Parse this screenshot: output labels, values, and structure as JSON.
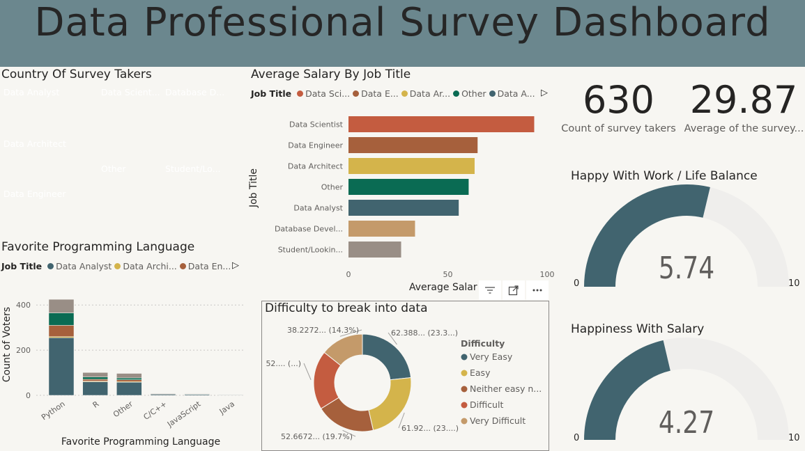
{
  "header": {
    "title": "Data Professional Survey Dashboard"
  },
  "treemap": {
    "title": "Country Of Survey Takers",
    "tiles": [
      {
        "label": "Data Analyst",
        "color": "#41646f"
      },
      {
        "label": "Data Architect",
        "color": "#d4b44b"
      },
      {
        "label": "Data Engineer",
        "color": "#a6603c"
      },
      {
        "label": "Data Scient...",
        "color": "#c45c40"
      },
      {
        "label": "Other",
        "color": "#0a6b53"
      },
      {
        "label": "Database D...",
        "color": "#c49a6a"
      },
      {
        "label": "Student/Lo...",
        "color": "#998e86"
      }
    ]
  },
  "salary_chart": {
    "title": "Average Salary By Job Title",
    "legend_title": "Job Title",
    "legend_items": [
      {
        "label": "Data Sci...",
        "color": "#c45c40"
      },
      {
        "label": "Data E...",
        "color": "#a6603c"
      },
      {
        "label": "Data Ar...",
        "color": "#d4b44b"
      },
      {
        "label": "Other",
        "color": "#0a6b53"
      },
      {
        "label": "Data A...",
        "color": "#41646f"
      }
    ],
    "ylabel": "Job Title",
    "xlabel": "Average Salar"
  },
  "kpis": {
    "count_value": "630",
    "count_label": "Count of survey takers",
    "age_value": "29.87",
    "age_label": "Average of the survey..."
  },
  "gauge_work": {
    "title": "Happy With Work / Life Balance",
    "value": 5.74,
    "value_text": "5.74",
    "min": "0",
    "max": "10",
    "fill_color": "#41646f",
    "track_color": "#efeeec"
  },
  "gauge_salary": {
    "title": "Happiness With Salary",
    "value": 4.27,
    "value_text": "4.27",
    "min": "0",
    "max": "10",
    "fill_color": "#41646f",
    "track_color": "#efeeec"
  },
  "lang_chart": {
    "title": "Favorite Programming Language",
    "legend_title": "Job Title",
    "legend_items": [
      {
        "label": "Data Analyst",
        "color": "#41646f"
      },
      {
        "label": "Data Archi...",
        "color": "#d4b44b"
      },
      {
        "label": "Data En...",
        "color": "#a6603c"
      }
    ],
    "ylabel": "Count of Voters",
    "xlabel": "Favorite Programming Language"
  },
  "donut": {
    "title": "Difficulty to break into data",
    "legend_title": "Difficulty",
    "labels": {
      "very_easy": "62.388... (23.3...)",
      "easy": "61.92... (23....)",
      "neither": "52.6672... (19.7%)",
      "difficult": "52.... (...)",
      "very_difficult": "38.2272... (14.3%)"
    }
  },
  "chart_data": [
    {
      "type": "bar",
      "orientation": "horizontal",
      "title": "Average Salary By Job Title",
      "xlabel": "Average Salar",
      "ylabel": "Job Title",
      "categories": [
        "Data Scientist",
        "Data Engineer",
        "Data Architect",
        "Other",
        "Data Analyst",
        "Database Devel...",
        "Student/Lookin..."
      ],
      "values": [
        93.5,
        65,
        63.5,
        60.5,
        55.5,
        33.5,
        26.5
      ],
      "colors": [
        "#c45c40",
        "#a6603c",
        "#d4b44b",
        "#0a6b53",
        "#41646f",
        "#c49a6a",
        "#998e86"
      ],
      "xlim": [
        0,
        100
      ],
      "xticks": [
        "0",
        "50",
        "100"
      ]
    },
    {
      "type": "bar",
      "stacked": true,
      "title": "Favorite Programming Language",
      "xlabel": "Favorite Programming Language",
      "ylabel": "Count of Voters",
      "categories": [
        "Python",
        "R",
        "Other",
        "C/C++",
        "JavaScript",
        "Java"
      ],
      "series": [
        {
          "name": "Data Analyst",
          "color": "#41646f",
          "values": [
            255,
            60,
            58,
            5,
            4,
            2
          ]
        },
        {
          "name": "Data Architect",
          "color": "#d4b44b",
          "values": [
            5,
            3,
            3,
            0,
            1,
            0
          ]
        },
        {
          "name": "Data Engineer",
          "color": "#a6603c",
          "values": [
            50,
            8,
            8,
            2,
            1,
            1
          ]
        },
        {
          "name": "Other",
          "color": "#0a6b53",
          "values": [
            55,
            10,
            8,
            1,
            1,
            0
          ]
        },
        {
          "name": "Data Scientist",
          "color": "#998e86",
          "values": [
            60,
            20,
            20,
            2,
            2,
            1
          ]
        }
      ],
      "ylim": [
        0,
        450
      ],
      "yticks": [
        "0",
        "200",
        "400"
      ]
    },
    {
      "type": "pie",
      "donut": true,
      "title": "Difficulty to break into data",
      "legend_title": "Difficulty",
      "categories": [
        "Very Easy",
        "Easy",
        "Neither easy n...",
        "Difficult",
        "Very Difficult"
      ],
      "values": [
        62.388,
        61.92,
        52.6672,
        52.5,
        38.2272
      ],
      "percents": [
        23.3,
        23.1,
        19.7,
        19.6,
        14.3
      ],
      "colors": [
        "#41646f",
        "#d4b44b",
        "#a6603c",
        "#c45c40",
        "#c49a6a"
      ]
    }
  ]
}
